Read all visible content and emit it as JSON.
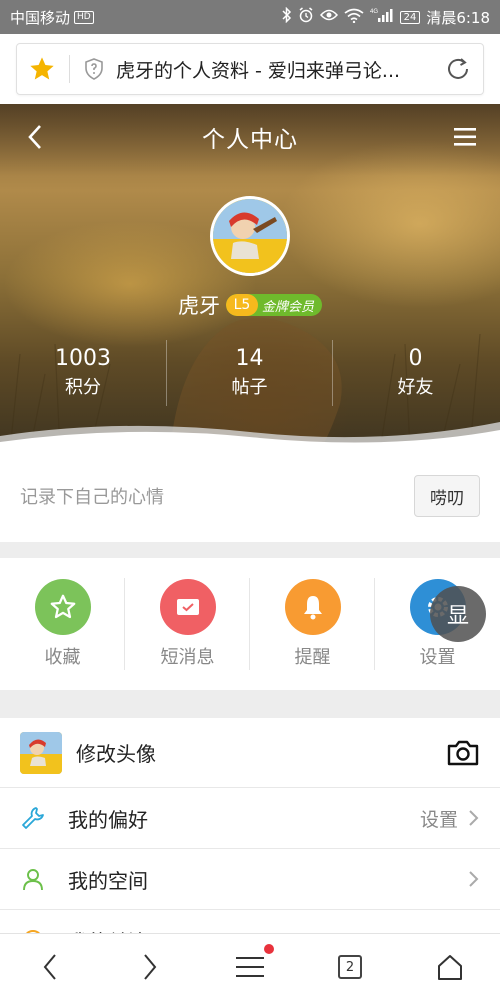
{
  "status_bar": {
    "carrier": "中国移动",
    "hd": "HD",
    "battery": "24",
    "time": "清晨6:18",
    "signal_label": "4G"
  },
  "url_bar": {
    "title": "虎牙的个人资料 - 爱归来弹弓论..."
  },
  "header": {
    "title": "个人中心"
  },
  "profile": {
    "username": "虎牙",
    "level": "L5",
    "level_label": "金牌会员"
  },
  "stats": [
    {
      "value": "1003",
      "label": "积分"
    },
    {
      "value": "14",
      "label": "帖子"
    },
    {
      "value": "0",
      "label": "好友"
    }
  ],
  "mood": {
    "placeholder": "记录下自己的心情",
    "button": "唠叨"
  },
  "quick_actions": [
    {
      "label": "收藏",
      "icon": "star-icon",
      "color": "#7cc35a"
    },
    {
      "label": "短消息",
      "icon": "message-icon",
      "color": "#f06064"
    },
    {
      "label": "提醒",
      "icon": "bell-icon",
      "color": "#f89b32"
    },
    {
      "label": "设置",
      "icon": "gear-icon",
      "color": "#2e8fd6"
    }
  ],
  "float_button": "显",
  "list": {
    "change_avatar": "修改头像",
    "preferences": "我的偏好",
    "preferences_value": "设置",
    "my_space": "我的空间",
    "cut_off": "我的关注"
  },
  "bottom_nav": {
    "tab_count": "2"
  },
  "colors": {
    "level_green": "#6fba2c",
    "level_orange": "#f6b91d",
    "notify_red": "#e8323c"
  }
}
